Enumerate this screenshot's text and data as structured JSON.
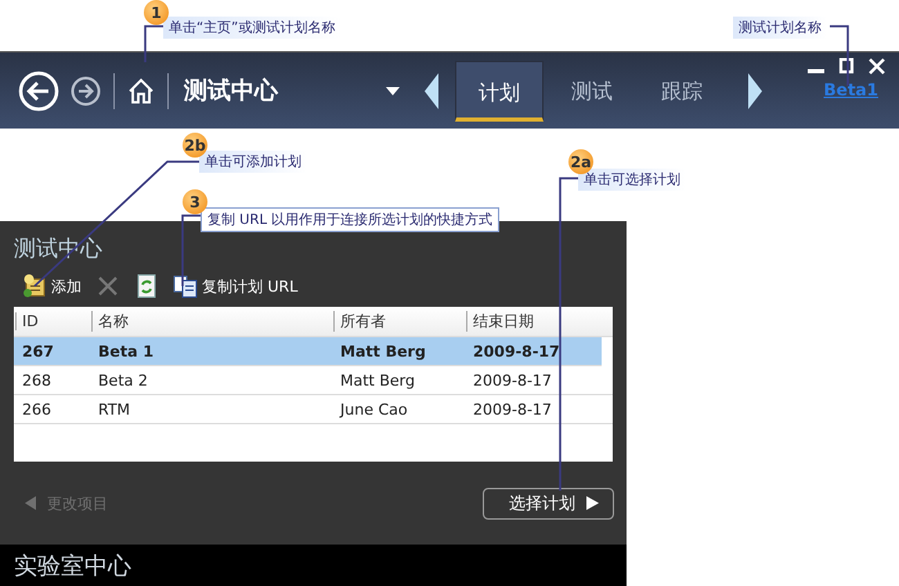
{
  "header": {
    "title": "测试中心",
    "tabs": [
      {
        "label": "计划",
        "selected": true
      },
      {
        "label": "测试",
        "selected": false
      },
      {
        "label": "跟踪",
        "selected": false
      }
    ],
    "plan_link": "Beta1"
  },
  "panel": {
    "title": "测试中心",
    "toolbar": [
      {
        "kind": "add",
        "label": "添加"
      },
      {
        "kind": "delete"
      },
      {
        "kind": "refresh"
      },
      {
        "kind": "copy",
        "label": "复制计划 URL"
      }
    ],
    "table": {
      "columns": [
        "ID",
        "名称",
        "所有者",
        "结束日期"
      ],
      "rows": [
        {
          "cells": [
            "267",
            "Beta 1",
            "Matt Berg",
            "2009-8-17"
          ],
          "selected": true
        },
        {
          "cells": [
            "268",
            "Beta 2",
            "Matt Berg",
            "2009-8-17"
          ],
          "selected": false
        },
        {
          "cells": [
            "266",
            "RTM",
            "June Cao",
            "2009-8-17"
          ],
          "selected": false
        }
      ]
    },
    "back_link": {
      "label": "更改项目",
      "disabled": true
    },
    "select_button": "选择计划",
    "footer": "实验室中心"
  },
  "callouts": [
    {
      "badge": "1",
      "text": "单击“主页”或测试计划名称"
    },
    {
      "text": "测试计划名称"
    },
    {
      "badge": "2b",
      "text": "单击可添加计划"
    },
    {
      "badge": "3",
      "text": "复制 URL 以用作用于连接所选计划的快捷方式",
      "boxed": true
    },
    {
      "badge": "2a",
      "text": "单击可选择计划"
    }
  ]
}
